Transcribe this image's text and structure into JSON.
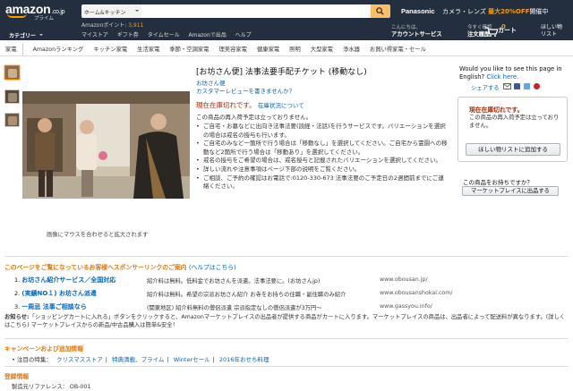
{
  "header": {
    "logo_text": "amazon",
    "logo_suffix": ".co.jp",
    "logo_sub": "プライム",
    "category_select": "ホーム&キッチン",
    "search_placeholder": "",
    "brand": "Panasonic",
    "promo_text": "カメラ・レンズ",
    "promo_highlight": "最大20%OFF",
    "promo_tail": "開催中",
    "points_label": "Amazonポイント:",
    "points_value": "3,911",
    "categories_label": "カテゴリー",
    "nav_links": [
      "マイストア",
      "ギフト券",
      "タイムセール",
      "Amazonで出品",
      "ヘルプ"
    ],
    "account_greeting": "こんにちは、",
    "account_label": "アカウントサービス",
    "orders_top": "今すぐ確認",
    "orders_label": "注文履歴",
    "cart_count": "0",
    "cart_label": "カート",
    "wishlist_top": "ほしい物",
    "wishlist_label": "リスト"
  },
  "subnav": [
    "家電",
    "Amazonランキング",
    "キッチン家電",
    "生活家電",
    "季節・空調家電",
    "理美容家電",
    "健康家電",
    "照明",
    "大型家電",
    "浄水器",
    "お買い得家電・セール"
  ],
  "gallery": {
    "zoom_hint": "画像にマウスを合わせると拡大されます"
  },
  "product": {
    "title": "[お坊さん便] 法事法要手配チケット (移動なし)",
    "byline": "お坊さん便",
    "review_link": "カスタマーレビューを書きませんか？",
    "stock_status": "現在在庫切れです。",
    "stock_link": "在庫状況について",
    "stock_note": "この商品の再入荷予定は立っておりません。",
    "bullets": [
      "ご自宅・お墓などに出向き法事法要(読経・法話)を行うサービスです。バリエーションを選択の場合は戒名の授与も行います。",
      "ご自宅のみなど一箇所で行う場合は「移動なし」を選択してください。ご自宅から霊園への移動など2箇所で行う場合は「移動あり」を選択してください。",
      "戒名の授与をご希望の場合は、戒名授与と記載されたバリエーションを選択してください。",
      "詳しい流れや注意事項はページ下部の説明をご覧ください。",
      "ご相談、ご予約の確認はお電話で:0120-330-673 法事法要のご予定日の2週間前までにご連絡ください。"
    ]
  },
  "sidebar": {
    "lang_question": "Would you like to see this page in English?",
    "lang_link": "Click here.",
    "share_label": "シェアする",
    "buybox_status": "現在在庫切れです。",
    "buybox_note": "この商品の再入荷予定は立っておりません。",
    "wishlist_button": "ほしい物リストに追加する",
    "sell_question": "この商品をお持ちですか？",
    "sell_button": "マーケットプレイスに出品する"
  },
  "ads": {
    "heading": "このページをご覧になっているお客様へスポンサーリンクのご案内",
    "help_link": "(ヘルプはこちら)",
    "rows": [
      {
        "num": "1.",
        "title": "お坊さん紹介サービス／全国対応",
        "desc": "紹介料は無料。低料金でお坊さんを派遣。法事法要に。(お坊さんjp)",
        "url": "www.obousan.jp/"
      },
      {
        "num": "2.",
        "title": "(実績NO１) お坊さん派遣",
        "desc": "紹介料は無料。希望の宗派お坊さん紹介 お寺をお持ちの住職・副住職のみ紹介",
        "url": "www.obousanshokai.com/"
      },
      {
        "num": "3.",
        "title": "一周忌 法事ご相談なら",
        "desc": "(関東地区) 紹介料無料の僧侶派遣 宗派指定なしの僧侶派遣が3万円〜",
        "url": "www.gassyou.info/"
      }
    ],
    "notice_bold": "お知らせ:",
    "notice_text": "「ショッピングカートに入れる」ボタンをクリックすると、Amazonマーケットプレイスの出品者が提供する商品がカートに入ります。マーケットプレイスの商品は、出品者によって配送料が異なります。(詳しくはこちら) マーケットプレイスからの新品/中古品購入は簡単&安全！"
  },
  "campaign": {
    "heading": "キャンペーンおよび追加情報",
    "label": "注目の特集：",
    "links": [
      "クリスマスストア",
      "特典満載、プライム",
      "Winterセール",
      "2016年おせち料理"
    ]
  },
  "registration": {
    "heading": "登録情報",
    "ref_label": "製造元リファレンス：",
    "ref_value": "OB-001"
  },
  "colors": {
    "header_bg": "#232f3e",
    "accent_orange": "#f90",
    "link_blue": "#0066c0",
    "stock_red": "#b12704",
    "section_orange": "#e47911"
  }
}
